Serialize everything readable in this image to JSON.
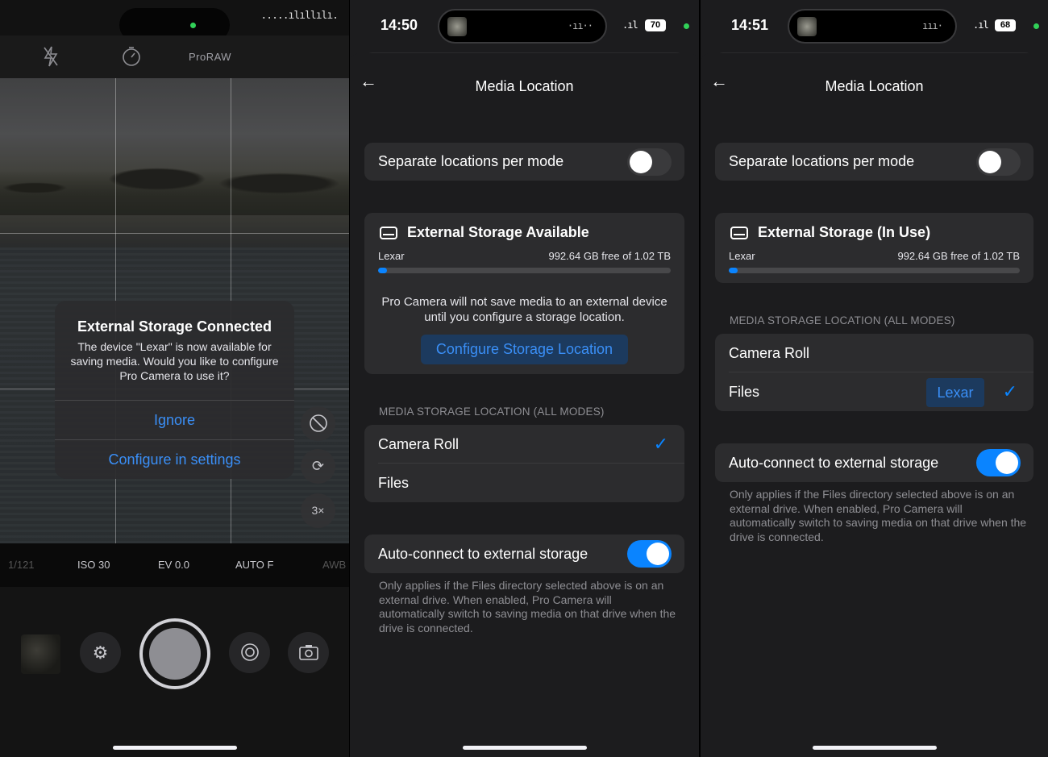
{
  "camera": {
    "toolbar": {
      "flash_icon": "flash-off-icon",
      "timer_icon": "timer-icon",
      "format": "ProRAW"
    },
    "alert": {
      "title": "External Storage Connected",
      "message": "The device \"Lexar\" is now available for saving media. Would you like to configure Pro Camera to use it?",
      "ignore": "Ignore",
      "configure": "Configure in settings"
    },
    "side_buttons": {
      "zoom": "3×"
    },
    "settings": {
      "shutter": "1/121",
      "iso": "ISO 30",
      "ev": "EV 0.0",
      "focus": "AUTO F",
      "wb": "AWB"
    }
  },
  "screen_before": {
    "time": "14:50",
    "battery": "70",
    "title": "Media Location",
    "separate_locations": {
      "label": "Separate locations per mode",
      "on": false
    },
    "storage": {
      "title": "External Storage Available",
      "device": "Lexar",
      "free": "992.64 GB free of 1.02 TB",
      "used_fraction": 0.03,
      "note": "Pro Camera will not save media to an external device until you configure a storage location.",
      "configure_button": "Configure Storage Location"
    },
    "section_header": "MEDIA STORAGE LOCATION (ALL MODES)",
    "locations": [
      {
        "label": "Camera Roll",
        "selected": true
      },
      {
        "label": "Files",
        "selected": false
      }
    ],
    "auto_connect": {
      "label": "Auto-connect to external storage",
      "on": true,
      "footnote": "Only applies if the Files directory selected above is on an external drive. When enabled, Pro Camera will automatically switch to saving media on that drive when the drive is connected."
    }
  },
  "screen_after": {
    "time": "14:51",
    "battery": "68",
    "title": "Media Location",
    "separate_locations": {
      "label": "Separate locations per mode",
      "on": false
    },
    "storage": {
      "title": "External Storage (In Use)",
      "device": "Lexar",
      "free": "992.64 GB free of 1.02 TB",
      "used_fraction": 0.03
    },
    "section_header": "MEDIA STORAGE LOCATION (ALL MODES)",
    "locations": [
      {
        "label": "Camera Roll",
        "selected": false
      },
      {
        "label": "Files",
        "selected": true,
        "chip": "Lexar"
      }
    ],
    "auto_connect": {
      "label": "Auto-connect to external storage",
      "on": true,
      "footnote": "Only applies if the Files directory selected above is on an external drive. When enabled, Pro Camera will automatically switch to saving media on that drive when the drive is connected."
    }
  },
  "colors": {
    "accent": "#0a84ff",
    "link": "#3a8ff7",
    "background": "#1c1c1e",
    "card": "#2c2c2e"
  }
}
